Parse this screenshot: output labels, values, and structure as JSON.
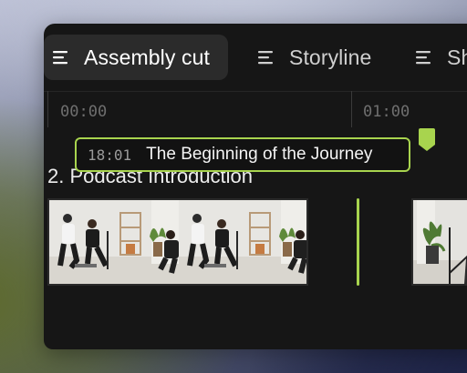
{
  "tabs": [
    {
      "label": "Assembly cut",
      "active": true,
      "icon": "list-icon"
    },
    {
      "label": "Storyline",
      "active": false,
      "icon": "list-icon"
    },
    {
      "label": "Sh",
      "active": false,
      "icon": "list-icon"
    }
  ],
  "ruler": {
    "ticks": [
      "00:00",
      "01:00"
    ]
  },
  "section": {
    "title": "2. Podcast Introduction"
  },
  "marker": {
    "time": "18:01",
    "title": "The Beginning of the Journey"
  },
  "colors": {
    "accent": "#a8d44e",
    "panel": "#161616",
    "active_tab": "#2b2b2b"
  }
}
